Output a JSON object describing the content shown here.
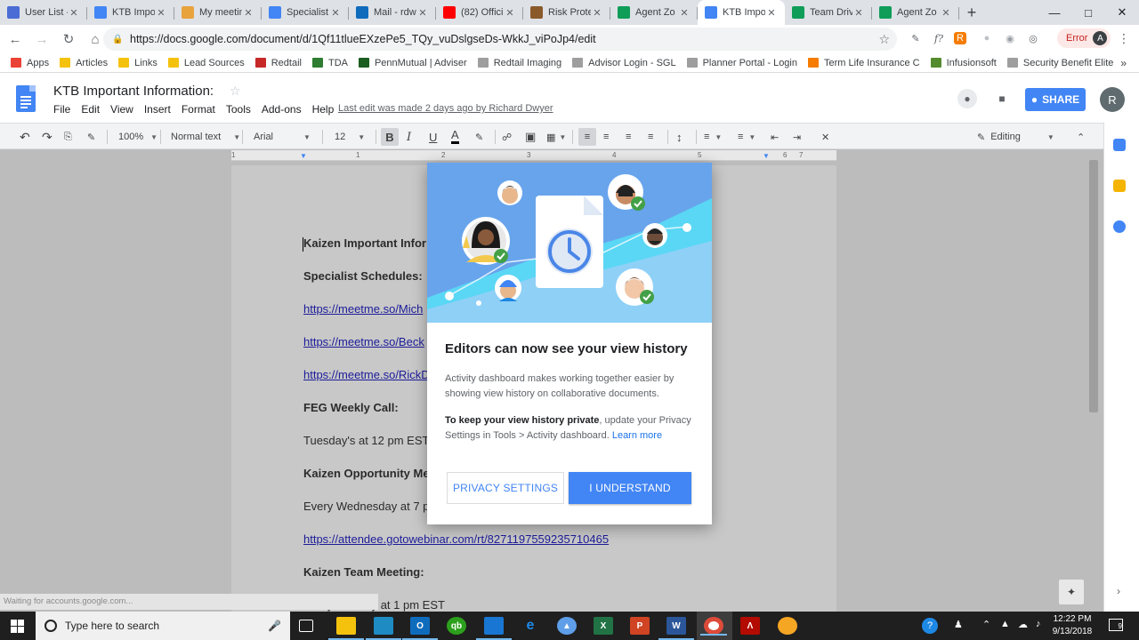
{
  "browser": {
    "tabs": [
      {
        "title": "User List -",
        "color": "#4a6cd4",
        "active": false
      },
      {
        "title": "KTB Impo",
        "color": "#4285f4",
        "active": false
      },
      {
        "title": "My meetin",
        "color": "#e8a33d",
        "active": false
      },
      {
        "title": "Specialist",
        "color": "#4285f4",
        "active": false
      },
      {
        "title": "Mail - rdw",
        "color": "#0f6cbd",
        "active": false
      },
      {
        "title": "(82) Offici",
        "color": "#ff0000",
        "active": false
      },
      {
        "title": "Risk Prote",
        "color": "#8a5a2b",
        "active": false
      },
      {
        "title": "Agent Zo",
        "color": "#0f9d58",
        "active": false
      },
      {
        "title": "KTB Impo",
        "color": "#4285f4",
        "active": true
      },
      {
        "title": "Team Driv",
        "color": "#0f9d58",
        "active": false
      },
      {
        "title": "Agent Zo",
        "color": "#0f9d58",
        "active": false
      }
    ],
    "url": "https://docs.google.com/document/d/1Qf11tlueEXzePe5_TQy_vuDslgseDs-WkkJ_viPoJp4/edit",
    "error_label": "Error",
    "profile_initial": "A",
    "bookmarks": [
      {
        "label": "Apps",
        "color": "#ea4335"
      },
      {
        "label": "Articles",
        "color": "#f4c20d"
      },
      {
        "label": "Links",
        "color": "#f4c20d"
      },
      {
        "label": "Lead Sources",
        "color": "#f4c20d"
      },
      {
        "label": "Redtail",
        "color": "#c62828"
      },
      {
        "label": "TDA",
        "color": "#2e7d32"
      },
      {
        "label": "PennMutual | Adviser",
        "color": "#1b5e20"
      },
      {
        "label": "Redtail Imaging",
        "color": "#9e9e9e"
      },
      {
        "label": "Advisor Login - SGL",
        "color": "#9e9e9e"
      },
      {
        "label": "Planner Portal - Login",
        "color": "#9e9e9e"
      },
      {
        "label": "Term Life Insurance C",
        "color": "#f57c00"
      },
      {
        "label": "Infusionsoft",
        "color": "#558b2f"
      },
      {
        "label": "Security Benefit Elite",
        "color": "#9e9e9e"
      }
    ],
    "more_bookmarks": "»"
  },
  "docs": {
    "title": "KTB Important Information:",
    "menu": [
      "File",
      "Edit",
      "View",
      "Insert",
      "Format",
      "Tools",
      "Add-ons",
      "Help"
    ],
    "last_edit": "Last edit was made 2 days ago by Richard Dwyer",
    "share_label": "SHARE",
    "avatar_initial": "R",
    "toolbar": {
      "zoom": "100%",
      "style": "Normal text",
      "font": "Arial",
      "size": "12",
      "mode": "Editing"
    },
    "ruler_numbers": [
      "1",
      "1",
      "2",
      "3",
      "4",
      "5",
      "6",
      "7"
    ],
    "lines": [
      {
        "text": "Kaizen Important Infor",
        "style": "b"
      },
      {
        "text": "Specialist Schedules:",
        "style": "b"
      },
      {
        "text": "https://meetme.so/Mich",
        "style": "link"
      },
      {
        "text": "https://meetme.so/Beck",
        "style": "link"
      },
      {
        "text": "https://meetme.so/RickD",
        "style": "link"
      },
      {
        "text": "FEG Weekly Call:",
        "style": "b"
      },
      {
        "text": "Tuesday's at 12 pm EST",
        "style": ""
      },
      {
        "text": "Kaizen Opportunity Me",
        "style": "b"
      },
      {
        "text": "Every Wednesday at 7 p",
        "style": ""
      },
      {
        "text": "https://attendee.gotowebinar.com/rt/8271197559235710465",
        "style": "link"
      },
      {
        "text": "Kaizen Team Meeting:",
        "style": "b"
      },
      {
        "text": "Every Monday at 1 pm EST",
        "style": ""
      }
    ],
    "status": "Waiting for accounts.google.com..."
  },
  "dialog": {
    "title": "Editors can now see your view history",
    "body": "Activity dashboard makes working together easier by showing view history on collaborative documents.",
    "body2_bold": "To keep your view history private",
    "body2_rest": ", update your Privacy Settings in Tools > Activity dashboard.",
    "learn_more": "Learn more",
    "privacy_button": "PRIVACY SETTINGS",
    "understand_button": "I UNDERSTAND"
  },
  "taskbar": {
    "search_placeholder": "Type here to search",
    "time": "12:22 PM",
    "date": "9/13/2018",
    "notification_count": "9"
  }
}
